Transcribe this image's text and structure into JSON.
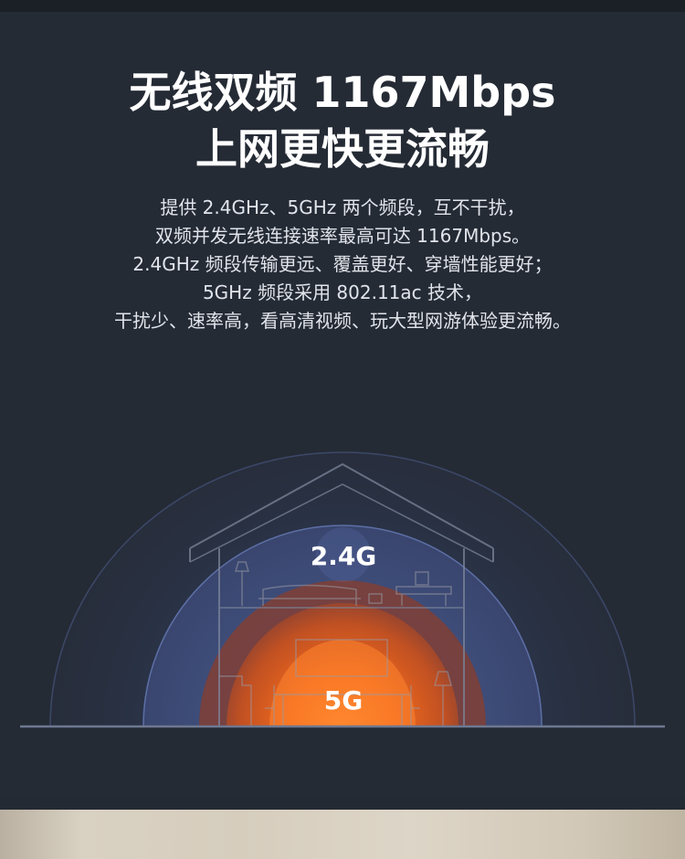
{
  "headline": {
    "line1": "无线双频 1167Mbps",
    "line2": "上网更快更流畅"
  },
  "description": [
    "提供 2.4GHz、5GHz 两个频段，互不干扰，",
    "双频并发无线连接速率最高可达 1167Mbps。",
    "2.4GHz 频段传输更远、覆盖更好、穿墙性能更好；",
    "5GHz 频段采用 802.11ac 技术，",
    "干扰少、速率高，看高清视频、玩大型网游体验更流畅。"
  ],
  "bands": {
    "outer_label": "2.4G",
    "inner_label": "5G"
  },
  "colors": {
    "background": "#252b35",
    "accent_orange": "#f06a1e",
    "wave_blue": "#4a5f92"
  }
}
